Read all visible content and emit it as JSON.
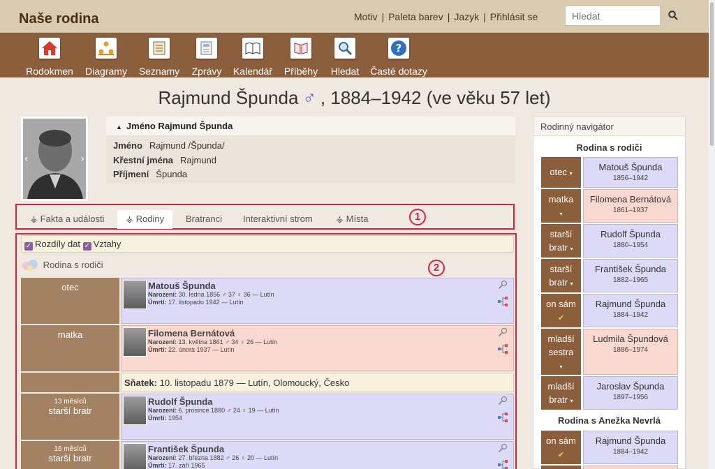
{
  "header": {
    "site_title": "Naše rodina",
    "links": [
      "Motiv",
      "Paleta barev",
      "Jazyk",
      "Přihlásit se"
    ],
    "search_placeholder": "Hledat"
  },
  "menu": [
    {
      "label": "Rodokmen",
      "icon": "home-icon"
    },
    {
      "label": "Diagramy",
      "icon": "diagram-icon"
    },
    {
      "label": "Seznamy",
      "icon": "list-icon"
    },
    {
      "label": "Zprávy",
      "icon": "report-icon"
    },
    {
      "label": "Kalendář",
      "icon": "calendar-icon"
    },
    {
      "label": "Příběhy",
      "icon": "book-icon"
    },
    {
      "label": "Hledat",
      "icon": "search-icon"
    },
    {
      "label": "Časté dotazy",
      "icon": "help-icon"
    }
  ],
  "person": {
    "name": "Rajmund Špunda",
    "sex_symbol": "♂",
    "years": ", 1884–1942 (ve věku 57 let)"
  },
  "name_box": {
    "heading": "Jméno Rajmund Špunda",
    "rows": [
      {
        "label": "Jméno",
        "value": "Rajmund /Špunda/"
      },
      {
        "label": "Křestní jména",
        "value": "Rajmund"
      },
      {
        "label": "Příjmení",
        "value": "Špunda"
      }
    ]
  },
  "tabs": [
    "Fakta a události",
    "Rodiny",
    "Bratranci",
    "Interaktivní strom",
    "Místa"
  ],
  "active_tab": "Rodiny",
  "markers": [
    "1",
    "2"
  ],
  "options": {
    "dates_label": "Rozdíly dat",
    "relations_label": "Vztahy"
  },
  "family_heading": "Rodina s rodiči",
  "family_rows": [
    {
      "relation": "otec",
      "age_gap": "",
      "sex": "m",
      "name": "Matouš Špunda",
      "birth_label": "Narození:",
      "birth": "30. ledna 1856 ♂ 37 ♀ 36 — Lutín",
      "death_label": "Úmrtí:",
      "death": "17. listopadu 1942 — Lutín"
    },
    {
      "relation": "matka",
      "age_gap": "",
      "sex": "f",
      "name": "Filomena Bernátová",
      "birth_label": "Narození:",
      "birth": "13. května 1861 ♂ 34 ♀ 26 — Lutín",
      "death_label": "Úmrtí:",
      "death": "22. února 1937 — Lutín"
    },
    {
      "relation": "starší bratr",
      "age_gap": "13 měsíců",
      "sex": "m",
      "name": "Rudolf Špunda",
      "birth_label": "Narození:",
      "birth": "6. prosince 1880 ♂ 24 ♀ 19 — Lutín",
      "death_label": "Úmrtí:",
      "death": "1954"
    },
    {
      "relation": "starší bratr",
      "age_gap": "16 měsíců",
      "sex": "m",
      "name": "František Špunda",
      "birth_label": "Narození:",
      "birth": "27. března 1882 ♂ 26 ♀ 20 — Lutín",
      "death_label": "Úmrtí:",
      "death": "17. září 1965"
    }
  ],
  "marriage": {
    "label": "Sňatek:",
    "text": "10. listopadu 1879 — Lutín, Olomoucký, Česko"
  },
  "navigator": {
    "title": "Rodinný navigátor",
    "family1_title": "Rodina s rodiči",
    "family1": [
      {
        "rel": "otec",
        "mark": "▾",
        "name": "Matouš Špunda",
        "dates": "1856–1942",
        "sex": "m"
      },
      {
        "rel": "matka",
        "mark": "▾",
        "name": "Filomena Bernátová",
        "dates": "1861–1937",
        "sex": "f"
      },
      {
        "rel": "starší bratr",
        "mark": "▾",
        "name": "Rudolf Špunda",
        "dates": "1880–1954",
        "sex": "m"
      },
      {
        "rel": "starší bratr",
        "mark": "▾",
        "name": "František Špunda",
        "dates": "1882–1965",
        "sex": "m"
      },
      {
        "rel": "on sám",
        "mark": "✔",
        "name": "Rajmund Špunda",
        "dates": "1884–1942",
        "sex": "m"
      },
      {
        "rel": "mladší sestra",
        "mark": "▾",
        "name": "Ludmila Špundová",
        "dates": "1886–1974",
        "sex": "f"
      },
      {
        "rel": "mladší bratr",
        "mark": "▾",
        "name": "Jaroslav Špunda",
        "dates": "1897–1956",
        "sex": "m"
      }
    ],
    "family2_title": "Rodina s Anežka Nevrlá",
    "family2": [
      {
        "rel": "on sám",
        "mark": "✔",
        "name": "Rajmund Špunda",
        "dates": "1884–1942",
        "sex": "m"
      }
    ]
  },
  "colors": {
    "header_bg": "#d9cbb0",
    "menu_bg": "#8b5e3c",
    "male_bg": "#dcdaf7",
    "female_bg": "#f9d8d0",
    "highlight": "#d0263f"
  }
}
